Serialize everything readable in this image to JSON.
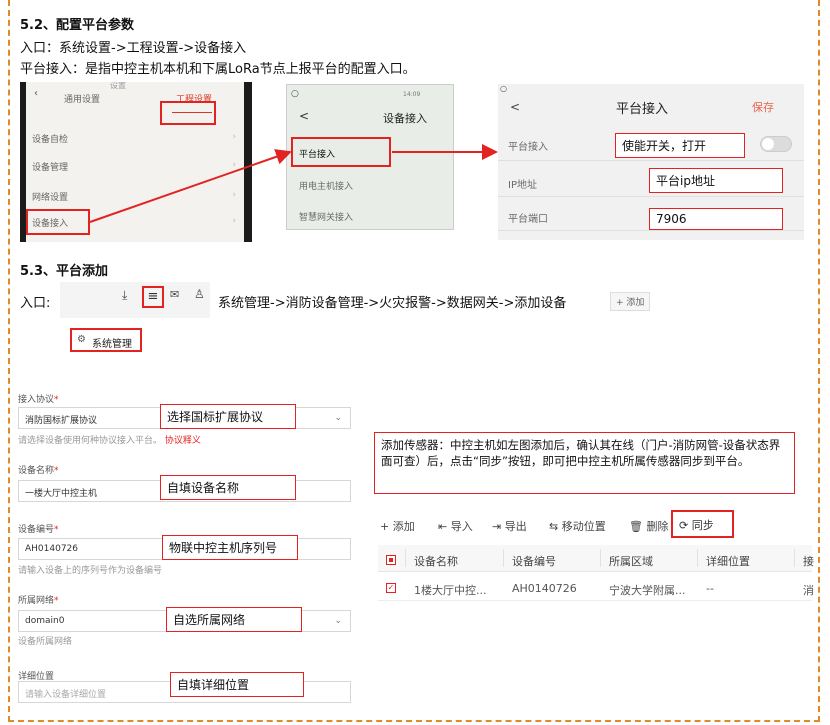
{
  "section52": {
    "title": "5.2、配置平台参数",
    "entry": "入口：系统设置->工程设置->设备接入",
    "desc": "平台接入：是指中控主机本机和下属LoRa节点上报平台的配置入口。"
  },
  "shot1": {
    "top_label": "设置",
    "tab_general": "通用设置",
    "tab_project": "工程设置",
    "items": [
      "设备自检",
      "设备管理",
      "网络设置",
      "设备接入"
    ]
  },
  "shot2": {
    "time": "14:09",
    "back": "<",
    "title": "设备接入",
    "items": [
      "平台接入",
      "用电主机接入",
      "智慧网关接入"
    ]
  },
  "shot3": {
    "back": "<",
    "title": "平台接入",
    "save": "保存",
    "rows": [
      "平台接入",
      "IP地址",
      "平台端口"
    ],
    "callout_enable": "使能开关，打开",
    "callout_ip": "平台ip地址",
    "callout_port": "7906"
  },
  "section53": {
    "title": "5.3、平台添加",
    "entry_label": "入口:",
    "path": "系统管理->消防设备管理->火灾报警->数据网关->添加设备",
    "add_btn": "+ 添加",
    "menu_item": "系统管理"
  },
  "form": {
    "protocol_label": "接入协议",
    "protocol_value": "消防国标扩展协议",
    "protocol_hint": "请选择设备使用何种协议接入平台。",
    "protocol_link": "协议释义",
    "protocol_callout": "选择国标扩展协议",
    "name_label": "设备名称",
    "name_value": "一楼大厅中控主机",
    "name_callout": "自填设备名称",
    "code_label": "设备编号",
    "code_value": "AH0140726",
    "code_hint": "请输入设备上的序列号作为设备编号",
    "code_callout": "物联中控主机序列号",
    "network_label": "所属网络",
    "network_value": "domain0",
    "network_hint": "设备所属网络",
    "network_callout": "自选所属网络",
    "location_label": "详细位置",
    "location_placeholder": "请输入设备详细位置",
    "location_callout": "自填详细位置"
  },
  "note": {
    "text": "添加传感器：中控主机如左图添加后，确认其在线（门户-消防网管-设备状态界面可查）后，点击“同步”按钮，即可把中控主机所属传感器同步到平台。"
  },
  "toolbar": {
    "add": "+ 添加",
    "import": "导入",
    "export": "导出",
    "move": "移动位置",
    "delete": "删除",
    "sync": "同步"
  },
  "table": {
    "headers": [
      "设备名称",
      "设备编号",
      "所属区域",
      "详细位置",
      "接"
    ],
    "row": [
      "1楼大厅中控...",
      "AH0140726",
      "宁波大学附属...",
      "--",
      "消"
    ]
  },
  "colors": {
    "accent_red": "#e32322",
    "border_orange": "#e08a2a"
  }
}
